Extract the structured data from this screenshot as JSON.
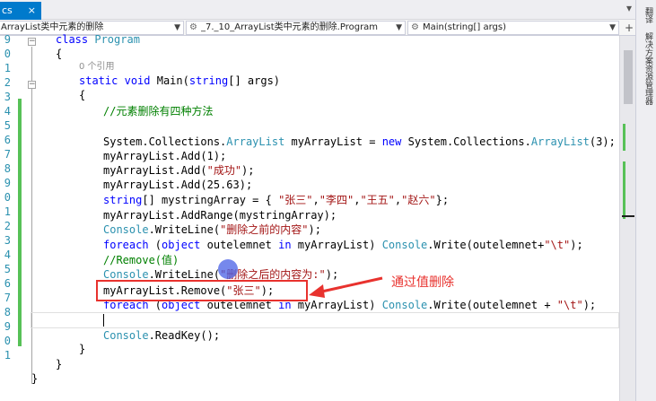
{
  "tab": {
    "label": "cs",
    "close": "×",
    "pin": "▾"
  },
  "navbar": {
    "project_combo": "ArrayList类中元素的删除",
    "class_combo": "_7._10_ArrayList类中元素的删除.Program",
    "member_combo": "Main(string[] args)",
    "split_button": "+"
  },
  "editor": {
    "line_numbers": [
      "9",
      "0",
      "1",
      "2",
      "3",
      "4",
      "5",
      "6",
      "7",
      "8",
      "9",
      "0",
      "1",
      "2",
      "3",
      "4",
      "5",
      "6",
      "7",
      "8",
      "9",
      "0",
      "1"
    ],
    "refs_hint": "0 个引用",
    "comment_methods": "//元素删除有四种方法",
    "comment_remove": "//Remove(值)"
  },
  "side_strip": {
    "items": [
      "翻译",
      "解决方案资源管理器"
    ]
  },
  "annotation": {
    "label": "通过值删除"
  },
  "colors": {
    "keyword": "#0000ff",
    "type": "#2b91af",
    "string": "#a31515",
    "comment": "#008000",
    "change_bar": "#57c157",
    "annotation_red": "#e8322e",
    "tab_active": "#007acc"
  }
}
